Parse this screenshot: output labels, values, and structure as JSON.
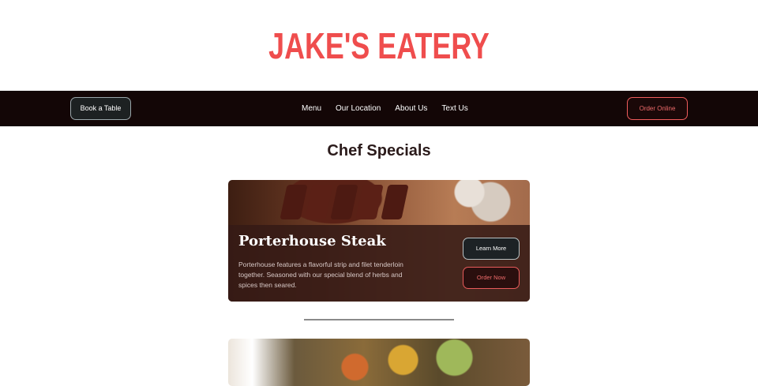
{
  "brand": {
    "name": "JAKE'S EATERY",
    "color": "#ef4d4d"
  },
  "nav": {
    "book_label": "Book a Table",
    "links": [
      "Menu",
      "Our Location",
      "About Us",
      "Text Us"
    ],
    "order_label": "Order Online"
  },
  "section": {
    "title": "Chef Specials"
  },
  "special": {
    "title": "Porterhouse Steak",
    "description": "Porterhouse features a flavorful strip and filet tenderloin together. Seasoned with our special blend of herbs and spices then seared.",
    "learn_label": "Learn More",
    "order_label": "Order Now"
  }
}
